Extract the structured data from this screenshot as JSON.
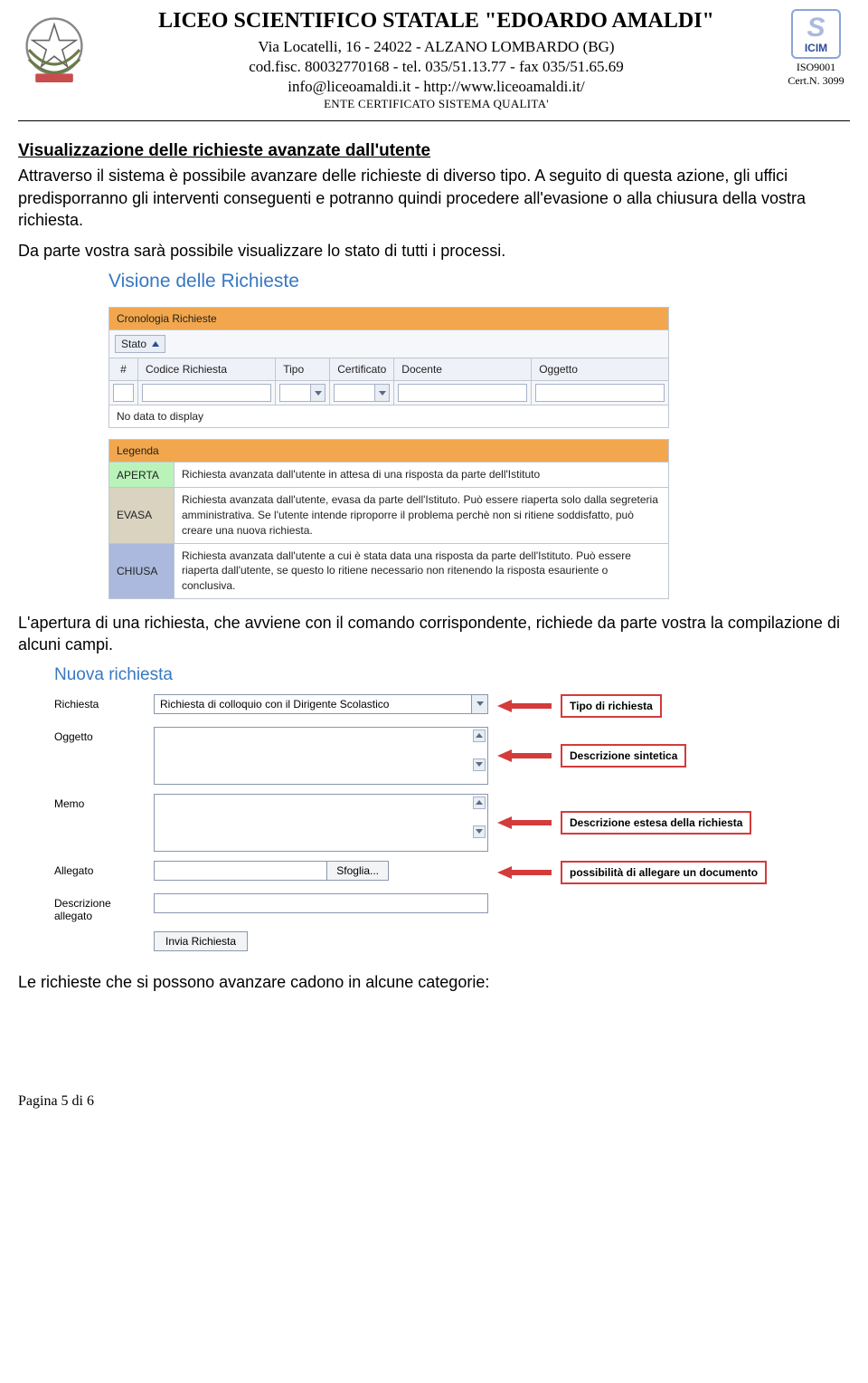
{
  "header": {
    "title": "LICEO SCIENTIFICO STATALE \"EDOARDO AMALDI\"",
    "addr": "Via Locatelli, 16 - 24022 - ALZANO LOMBARDO (BG)",
    "codfisc": "cod.fisc. 80032770168 - tel. 035/51.13.77 - fax 035/51.65.69",
    "contact": "info@liceoamaldi.it - http://www.liceoamaldi.it/",
    "quality": "ENTE CERTIFICATO SISTEMA QUALITA'",
    "iso": "ISO9001",
    "cert": "Cert.N. 3099",
    "icim": "ICIM"
  },
  "section": {
    "heading": "Visualizzazione delle richieste avanzate dall'utente",
    "p1": "Attraverso il sistema è possibile avanzare delle richieste di diverso tipo. A seguito di questa azione, gli uffici predisporranno gli interventi conseguenti e potranno quindi procedere all'evasione o alla chiusura della vostra richiesta.",
    "p2": "Da parte vostra sarà possibile visualizzare lo stato di tutti i processi."
  },
  "ss1": {
    "title": "Visione delle Richieste",
    "cronologia": "Cronologia Richieste",
    "stato": "Stato",
    "cols": {
      "num": "#",
      "codice": "Codice Richiesta",
      "tipo": "Tipo",
      "certificato": "Certificato",
      "docente": "Docente",
      "oggetto": "Oggetto"
    },
    "nodata": "No data to display",
    "legenda": "Legenda",
    "aperta_label": "APERTA",
    "aperta_desc": "Richiesta avanzata dall'utente in attesa di una risposta da parte dell'Istituto",
    "evasa_label": "EVASA",
    "evasa_desc": "Richiesta avanzata dall'utente, evasa da parte dell'Istituto. Può essere riaperta solo dalla segreteria amministrativa. Se l'utente intende riproporre il problema perchè non si ritiene soddisfatto, può creare una nuova richiesta.",
    "chiusa_label": "CHIUSA",
    "chiusa_desc": "Richiesta avanzata dall'utente a cui è stata data una risposta da parte dell'Istituto. Può essere riaperta dall'utente, se questo lo ritiene necessario non ritenendo la risposta esauriente o conclusiva."
  },
  "mid_text": "L'apertura di una richiesta, che avviene con il comando corrispondente, richiede da parte vostra la compilazione di alcuni campi.",
  "ss2": {
    "title": "Nuova richiesta",
    "labels": {
      "richiesta": "Richiesta",
      "oggetto": "Oggetto",
      "memo": "Memo",
      "allegato": "Allegato",
      "desc_allegato": "Descrizione allegato"
    },
    "richiesta_value": "Richiesta di colloquio con il Dirigente Scolastico",
    "sfoglia": "Sfoglia...",
    "submit": "Invia Richiesta",
    "callouts": {
      "tipo": "Tipo di richiesta",
      "sintetica": "Descrizione sintetica",
      "estesa": "Descrizione estesa della richiesta",
      "allegare": "possibilità di allegare un documento"
    }
  },
  "final_text": "Le richieste che si possono avanzare cadono in alcune categorie:",
  "footer": "Pagina 5 di 6"
}
